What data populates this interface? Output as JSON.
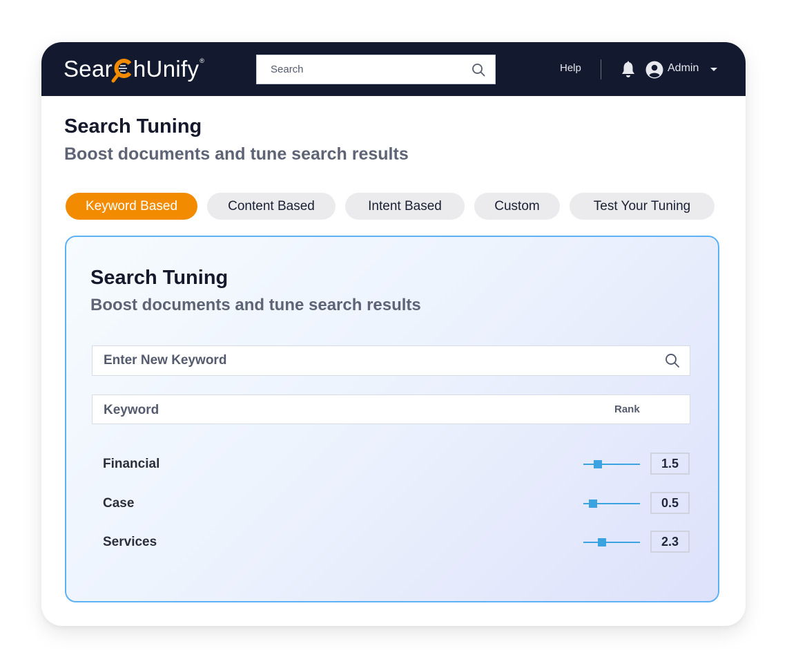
{
  "header": {
    "logo_text_left": "Sear",
    "logo_text_right": "hUnify",
    "logo_trademark": "®",
    "search_placeholder": "Search",
    "help_label": "Help",
    "user_label": "Admin",
    "icons": {
      "search": "search-icon",
      "notifications": "bell-icon",
      "user": "user-circle-icon",
      "dropdown": "caret-down-icon"
    }
  },
  "page": {
    "title": "Search Tuning",
    "subtitle": "Boost documents and tune search results"
  },
  "tabs": [
    {
      "label": "Keyword Based",
      "active": true
    },
    {
      "label": "Content Based",
      "active": false
    },
    {
      "label": "Intent Based",
      "active": false
    },
    {
      "label": "Custom",
      "active": false
    },
    {
      "label": "Test Your Tuning",
      "active": false
    }
  ],
  "card": {
    "title": "Search Tuning",
    "subtitle": "Boost documents and tune search results",
    "keyword_input_placeholder": "Enter New Keyword",
    "columns": {
      "keyword": "Keyword",
      "rank": "Rank"
    },
    "slider_range": [
      0,
      10
    ],
    "rows": [
      {
        "keyword": "Financial",
        "rank": "1.5",
        "value": 1.5
      },
      {
        "keyword": "Case",
        "rank": "0.5",
        "value": 0.5
      },
      {
        "keyword": "Services",
        "rank": "2.3",
        "value": 2.3
      }
    ]
  },
  "colors": {
    "header_bg": "#131a2f",
    "accent_orange": "#f28b00",
    "card_border": "#5db1f5",
    "slider": "#3aa3e0"
  }
}
